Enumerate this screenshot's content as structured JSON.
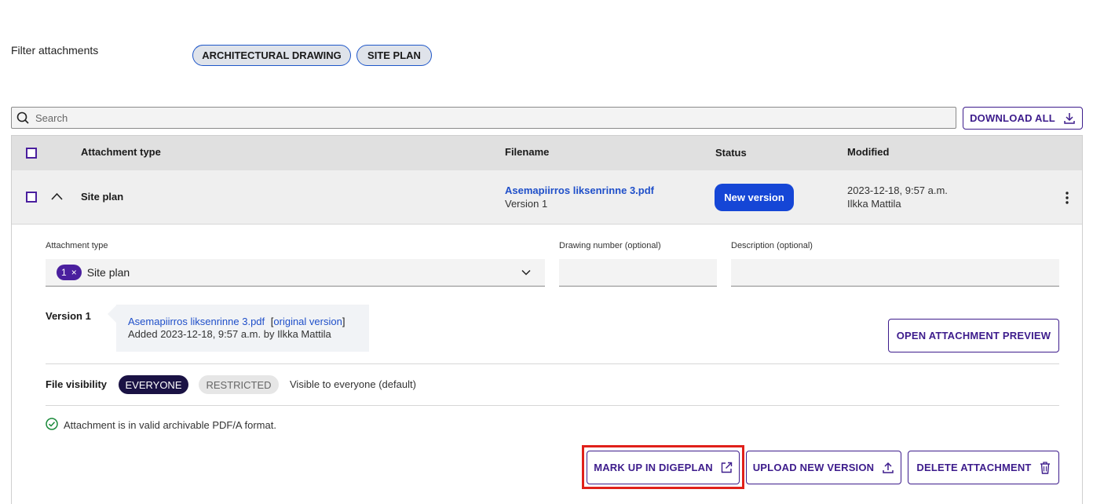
{
  "filter": {
    "label": "Filter attachments",
    "chips": [
      "ARCHITECTURAL DRAWING",
      "SITE PLAN"
    ]
  },
  "search": {
    "placeholder": "Search",
    "value": ""
  },
  "toolbar": {
    "download_all_label": "DOWNLOAD ALL"
  },
  "table": {
    "columns": [
      "Attachment type",
      "Filename",
      "Status",
      "Modified"
    ],
    "row": {
      "type": "Site plan",
      "filename": "Asemapiirros liksenrinne 3.pdf",
      "version": "Version 1",
      "status": "New version",
      "modified_date": "2023-12-18, 9:57 a.m.",
      "modified_by": "Ilkka Mattila"
    }
  },
  "details": {
    "attachment_type_label": "Attachment type",
    "attachment_type_count": "1",
    "attachment_type_remove": "×",
    "attachment_type_value": "Site plan",
    "drawing_number_label": "Drawing number (optional)",
    "drawing_number_value": "",
    "description_label": "Description (optional)",
    "description_value": "",
    "version_title": "Version 1",
    "version_file": "Asemapiirros liksenrinne 3.pdf",
    "version_bracket_open": "[",
    "version_original_link": "original version",
    "version_bracket_close": "]",
    "version_added": "Added 2023-12-18, 9:57 a.m. by Ilkka Mattila",
    "open_preview_label": "OPEN ATTACHMENT PREVIEW",
    "visibility_label": "File visibility",
    "visibility_everyone": "EVERYONE",
    "visibility_restricted": "RESTRICTED",
    "visibility_text": "Visible to everyone (default)",
    "pdfa_text": "Attachment is in valid archivable PDF/A format.",
    "markup_label": "MARK UP IN DIGEPLAN",
    "upload_label": "UPLOAD NEW VERSION",
    "delete_label": "DELETE ATTACHMENT"
  },
  "colors": {
    "accent_purple": "#3d1c8c",
    "status_blue": "#1546d6",
    "link_blue": "#1f4fc9",
    "highlight_red": "#e0201a",
    "success_green": "#1a8a3a"
  }
}
